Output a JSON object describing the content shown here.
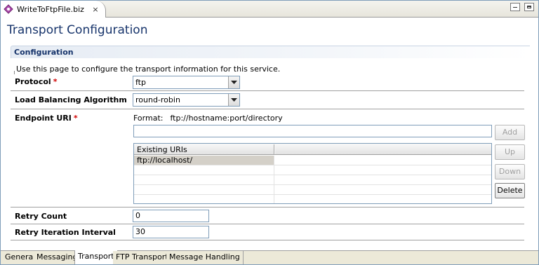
{
  "editor_tab": {
    "title": "WriteToFtpFile.biz",
    "close": "×"
  },
  "page": {
    "title": "Transport Configuration"
  },
  "section": {
    "title": "Configuration",
    "description": "Use this page to configure the transport information for this service."
  },
  "fields": {
    "protocol": {
      "label": "Protocol",
      "required": "*",
      "value": "ftp"
    },
    "load_balancing": {
      "label": "Load Balancing Algorithm",
      "value": "round-robin"
    },
    "endpoint_uri": {
      "label": "Endpoint URI",
      "required": "*",
      "format_label": "Format:",
      "format_value": "ftp://hostname:port/directory",
      "input_value": "",
      "table_header": "Existing URIs",
      "uris": [
        "ftp://localhost/",
        "",
        "",
        "",
        ""
      ]
    },
    "retry_count": {
      "label": "Retry Count",
      "value": "0"
    },
    "retry_interval": {
      "label": "Retry Iteration Interval",
      "value": "30"
    }
  },
  "buttons": {
    "add": "Add",
    "up": "Up",
    "down": "Down",
    "delete": "Delete"
  },
  "bottom_tabs": [
    "General",
    "Messaging",
    "Transport",
    "FTP Transport",
    "Message Handling"
  ],
  "active_bottom_tab": "Transport",
  "colors": {
    "title": "#17346b",
    "required": "#d00000",
    "selection": "#d4d0c8"
  },
  "icons": {
    "editor_tab": "business-service-icon",
    "dropdown": "chevron-down-icon"
  }
}
